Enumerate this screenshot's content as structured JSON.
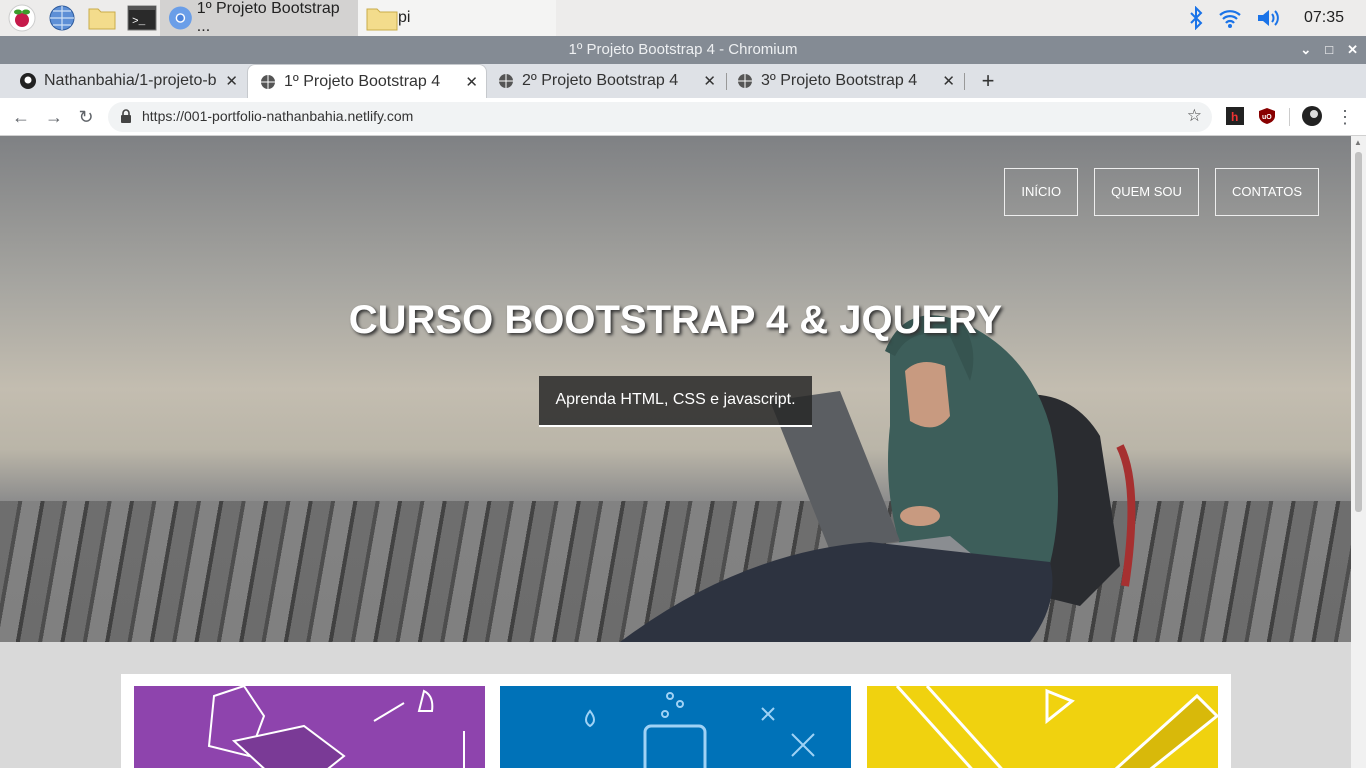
{
  "taskbar": {
    "tasks": [
      {
        "label": "1º Projeto Bootstrap ..."
      },
      {
        "label": "pi"
      }
    ],
    "clock": "07:35"
  },
  "window": {
    "title": "1º Projeto Bootstrap 4 - Chromium"
  },
  "tabs": [
    {
      "label": "Nathanbahia/1-projeto-b"
    },
    {
      "label": "1º Projeto Bootstrap 4"
    },
    {
      "label": "2º Projeto Bootstrap 4"
    },
    {
      "label": "3º Projeto Bootstrap 4"
    }
  ],
  "address": {
    "url": "https://001-portfolio-nathanbahia.netlify.com"
  },
  "page": {
    "nav": [
      "INÍCIO",
      "QUEM SOU",
      "CONTATOS"
    ],
    "hero_title": "CURSO BOOTSTRAP 4 & JQUERY",
    "hero_subtitle": "Aprenda HTML, CSS e javascript."
  },
  "colors": {
    "card1": "#8e44ad",
    "card2": "#0072b8",
    "card3": "#f0d20f",
    "titlebar": "#848b94"
  }
}
